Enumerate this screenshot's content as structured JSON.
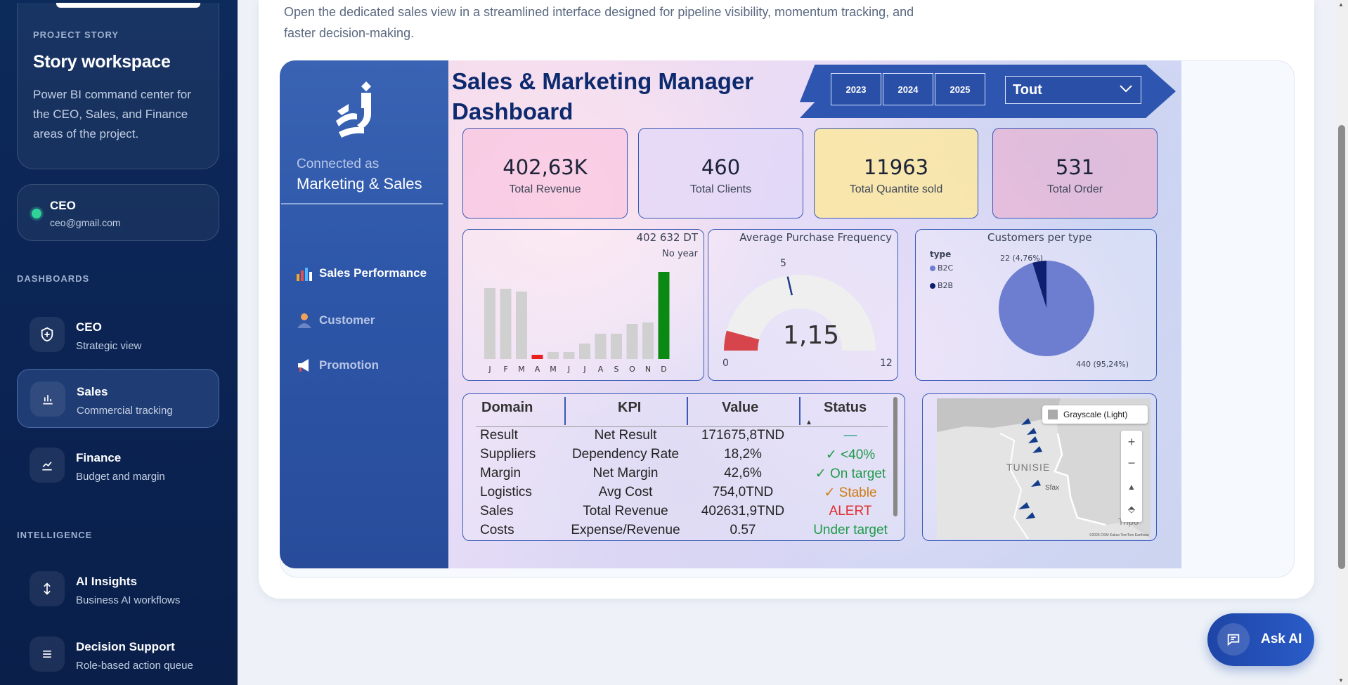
{
  "sidebar": {
    "story_label": "PROJECT STORY",
    "story_title": "Story workspace",
    "story_desc": "Power BI command center for the CEO, Sales, and Finance areas of the project.",
    "user_role": "CEO",
    "user_email": "ceo@gmail.com",
    "dash_label": "DASHBOARDS",
    "intel_label": "INTELLIGENCE",
    "items": [
      {
        "title": "CEO",
        "sub": "Strategic view",
        "icon": "shield-plus-icon"
      },
      {
        "title": "Sales",
        "sub": "Commercial tracking",
        "icon": "bar-chart-icon"
      },
      {
        "title": "Finance",
        "sub": "Budget and margin",
        "icon": "trend-line-icon"
      },
      {
        "title": "AI Insights",
        "sub": "Business AI workflows",
        "icon": "sparkle-arrows-icon"
      },
      {
        "title": "Decision Support",
        "sub": "Role-based action queue",
        "icon": "list-icon"
      }
    ]
  },
  "main": {
    "description": "Open the dedicated sales view in a streamlined interface designed for pipeline visibility, momentum tracking, and faster decision-making."
  },
  "report": {
    "connected_as": "Connected as",
    "connected_name": "Marketing & Sales",
    "nav": [
      {
        "label": "Sales Performance",
        "icon": "bar-chart-icon"
      },
      {
        "label": "Customer",
        "icon": "person-icon"
      },
      {
        "label": "Promotion",
        "icon": "megaphone-icon"
      }
    ],
    "title": "Sales & Marketing Manager Dashboard",
    "years": [
      "2023",
      "2024",
      "2025"
    ],
    "slicer_value": "Tout",
    "kpis": [
      {
        "value": "402,63K",
        "label": "Total Revenue"
      },
      {
        "value": "460",
        "label": "Total Clients"
      },
      {
        "value": "11963",
        "label": "Total Quantite sold"
      },
      {
        "value": "531",
        "label": "Total Order"
      }
    ],
    "bar_total": "402 632 DT",
    "bar_sub": "No year",
    "gauge_title": "Average Purchase Frequency",
    "gauge_value": "1,15",
    "gauge_min": "0",
    "gauge_max": "12",
    "gauge_target": "5",
    "pie_title": "Customers per type",
    "pie_legend_title": "type",
    "table": {
      "headers": [
        "Domain",
        "KPI",
        "Value",
        "Status"
      ],
      "rows": [
        {
          "domain": "Result",
          "kpi": "Net Result",
          "value": "171675,8TND",
          "status": "—",
          "color": "#2a9d8f"
        },
        {
          "domain": "Suppliers",
          "kpi": "Dependency Rate",
          "value": "18,2%",
          "status": "✓ <40%",
          "color": "#1f9a4a"
        },
        {
          "domain": "Margin",
          "kpi": "Net Margin",
          "value": "42,6%",
          "status": "✓ On target",
          "color": "#1f9a4a"
        },
        {
          "domain": "Logistics",
          "kpi": "Avg Cost",
          "value": "754,0TND",
          "status": "✓ Stable",
          "color": "#d07a10"
        },
        {
          "domain": "Sales",
          "kpi": "Total Revenue",
          "value": "402631,9TND",
          "status": "ALERT",
          "color": "#e03030"
        },
        {
          "domain": "Costs",
          "kpi": "Expense/Revenue",
          "value": "0.57",
          "status": "Under target",
          "color": "#1f9a4a"
        }
      ]
    },
    "map": {
      "style_label": "Grayscale (Light)",
      "country": "TUNISIE",
      "city1": "Sfax",
      "city2": "Tripo",
      "copyright": "©2026 OSM Kakao TomTom Earthstar"
    }
  },
  "chart_data": [
    {
      "type": "bar",
      "categories": [
        "J",
        "F",
        "M",
        "A",
        "M",
        "J",
        "J",
        "A",
        "S",
        "O",
        "N",
        "D"
      ],
      "values": [
        101,
        100,
        96,
        6,
        10,
        10,
        22,
        36,
        36,
        50,
        52,
        124
      ],
      "title": "402 632 DT",
      "subtitle": "No year",
      "colors": [
        "#d0d0d0",
        "#d0d0d0",
        "#d0d0d0",
        "#e82020",
        "#d0d0d0",
        "#d0d0d0",
        "#d0d0d0",
        "#d0d0d0",
        "#d0d0d0",
        "#d0d0d0",
        "#d0d0d0",
        "#0b8a13"
      ]
    },
    {
      "type": "pie",
      "title": "Customers per type",
      "categories": [
        "B2C",
        "B2B"
      ],
      "values": [
        440,
        22
      ],
      "labels": [
        "440 (95,24%)",
        "22 (4,76%)"
      ],
      "colors": [
        "#6d7ed0",
        "#0d1f6e"
      ]
    }
  ]
}
